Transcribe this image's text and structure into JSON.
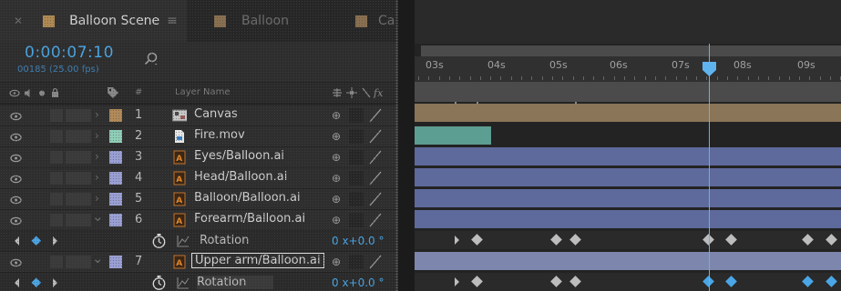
{
  "tabs": [
    {
      "label": "Balloon Scene",
      "active": true,
      "swatch": "#b08a52"
    },
    {
      "label": "Balloon",
      "active": false,
      "swatch": "#b08a52"
    },
    {
      "label": "Ca",
      "active": false,
      "swatch": "#b08a52"
    }
  ],
  "comp": {
    "timecode": "0:00:07:10",
    "frames": "00185 (25.00 fps)"
  },
  "header": {
    "layer_name": "Layer Name",
    "hash": "#"
  },
  "layers": [
    {
      "num": "1",
      "name": "Canvas",
      "color": "#b38a58",
      "type": "comp"
    },
    {
      "num": "2",
      "name": "Fire.mov",
      "color": "#8fcfb8",
      "type": "footage"
    },
    {
      "num": "3",
      "name": "Eyes/Balloon.ai",
      "color": "#9aa0d6",
      "type": "ai"
    },
    {
      "num": "4",
      "name": "Head/Balloon.ai",
      "color": "#9aa0d6",
      "type": "ai"
    },
    {
      "num": "5",
      "name": "Balloon/Balloon.ai",
      "color": "#9aa0d6",
      "type": "ai"
    },
    {
      "num": "6",
      "name": "Forearm/Balloon.ai",
      "color": "#9aa0d6",
      "type": "ai"
    },
    {
      "num": "7",
      "name": "Upper arm/Balloon.ai",
      "color": "#9aa0d6",
      "type": "ai"
    }
  ],
  "properties": [
    {
      "name": "Rotation",
      "value": "0 x+0.0 °"
    },
    {
      "name": "Rotation",
      "value": "0 x+0.0 °"
    }
  ],
  "ruler": {
    "labels": [
      "03s",
      "04s",
      "05s",
      "06s",
      "07s",
      "08s",
      "09s"
    ]
  },
  "colors": {
    "accent": "#4aa6e6",
    "tan_bar": "#8a7558",
    "teal_bar": "#5d9e92",
    "blue_bar": "#5e6a9c",
    "cti": "#5fb4ef"
  }
}
